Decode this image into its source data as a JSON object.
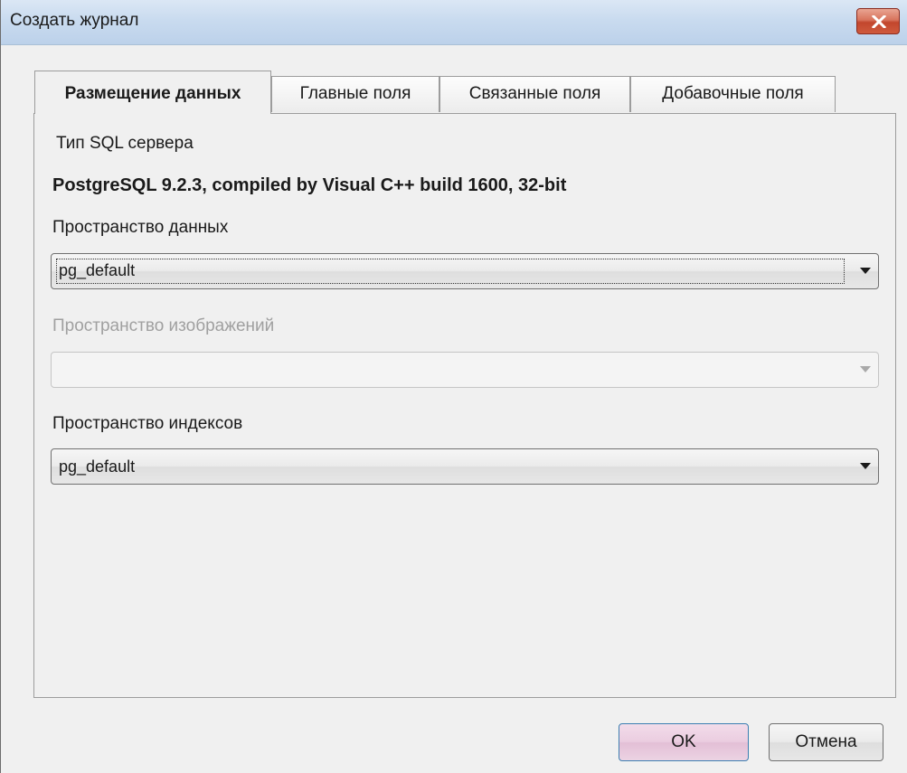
{
  "window": {
    "title": "Создать журнал"
  },
  "tabs": [
    {
      "label": "Размещение данных",
      "active": true
    },
    {
      "label": "Главные поля",
      "active": false
    },
    {
      "label": "Связанные поля",
      "active": false
    },
    {
      "label": "Добавочные поля",
      "active": false
    }
  ],
  "panel": {
    "server_type_label": "Тип SQL сервера",
    "server_type_value": "PostgreSQL 9.2.3, compiled by Visual C++ build 1600, 32-bit",
    "data_space": {
      "label": "Пространство данных",
      "value": "pg_default",
      "enabled": true
    },
    "image_space": {
      "label": "Пространство изображений",
      "value": "",
      "enabled": false
    },
    "index_space": {
      "label": "Пространство индексов",
      "value": "pg_default",
      "enabled": true
    }
  },
  "buttons": {
    "ok_label": "OK",
    "cancel_label": "Отмена"
  },
  "colors": {
    "titlebar": "#c9dbef",
    "close_button": "#c2462d",
    "ok_button": "#ebcde0",
    "window_background": "#f0f0f0"
  },
  "icons": {
    "close": "close-icon",
    "dropdown": "chevron-down-icon"
  }
}
